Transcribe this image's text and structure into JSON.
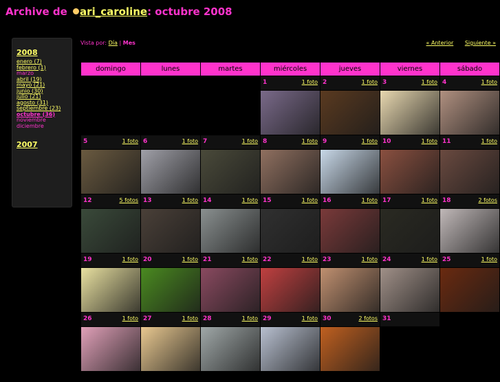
{
  "header": {
    "prefix": "Archive de",
    "user": "ari_caroline",
    "suffix": ": octubre 2008"
  },
  "view": {
    "label": "Vista por:",
    "day": "Día",
    "sep": "|",
    "month": "Mes",
    "prev": "« Anterior",
    "next": "Siguiente »"
  },
  "sidebar": {
    "year1": "2008",
    "months": [
      {
        "label": "enero (7)",
        "state": "link"
      },
      {
        "label": "febrero (1)",
        "state": "link"
      },
      {
        "label": "marzo",
        "state": "empty"
      },
      {
        "label": "abril (19)",
        "state": "link"
      },
      {
        "label": "mayo (21)",
        "state": "link"
      },
      {
        "label": "junio (30)",
        "state": "link"
      },
      {
        "label": "julio (21)",
        "state": "link"
      },
      {
        "label": "agosto (31)",
        "state": "link"
      },
      {
        "label": "septiembre (23)",
        "state": "link"
      },
      {
        "label": "octubre (36)",
        "state": "current"
      },
      {
        "label": "noviembre",
        "state": "empty"
      },
      {
        "label": "diciembre",
        "state": "empty"
      }
    ],
    "year2": "2007"
  },
  "calendar": {
    "daynames": [
      "domingo",
      "lunes",
      "martes",
      "miércoles",
      "jueves",
      "viernes",
      "sábado"
    ],
    "weeks": [
      [
        null,
        null,
        null,
        {
          "day": "1",
          "photos": "1 foto",
          "color": "#7a6a8a"
        },
        {
          "day": "2",
          "photos": "1 foto",
          "color": "#5a3a20"
        },
        {
          "day": "3",
          "photos": "1 foto",
          "color": "#e8d8b0"
        },
        {
          "day": "4",
          "photos": "1 foto",
          "color": "#b09080"
        }
      ],
      [
        {
          "day": "5",
          "photos": "1 foto",
          "color": "#6a5a40"
        },
        {
          "day": "6",
          "photos": "1 foto",
          "color": "#a0a0a8"
        },
        {
          "day": "7",
          "photos": "1 foto",
          "color": "#4a4a3a"
        },
        {
          "day": "8",
          "photos": "1 foto",
          "color": "#907060"
        },
        {
          "day": "9",
          "photos": "1 foto",
          "color": "#c8d8e8"
        },
        {
          "day": "10",
          "photos": "1 foto",
          "color": "#8a5040"
        },
        {
          "day": "11",
          "photos": "1 foto",
          "color": "#6a4a40"
        }
      ],
      [
        {
          "day": "12",
          "photos": "5 fotos",
          "color": "#3a4a3a"
        },
        {
          "day": "13",
          "photos": "1 foto",
          "color": "#4a4038"
        },
        {
          "day": "14",
          "photos": "1 foto",
          "color": "#8a9090"
        },
        {
          "day": "15",
          "photos": "1 foto",
          "color": "#303030"
        },
        {
          "day": "16",
          "photos": "1 foto",
          "color": "#7a3a3a"
        },
        {
          "day": "17",
          "photos": "1 foto",
          "color": "#2a2a22"
        },
        {
          "day": "18",
          "photos": "2 fotos",
          "color": "#c0b8b8"
        }
      ],
      [
        {
          "day": "19",
          "photos": "1 foto",
          "color": "#e8e0a0"
        },
        {
          "day": "20",
          "photos": "1 foto",
          "color": "#4a8a20"
        },
        {
          "day": "21",
          "photos": "1 foto",
          "color": "#8a4a60"
        },
        {
          "day": "22",
          "photos": "1 foto",
          "color": "#c04040"
        },
        {
          "day": "23",
          "photos": "1 foto",
          "color": "#c09070"
        },
        {
          "day": "24",
          "photos": "1 foto",
          "color": "#a09088"
        },
        {
          "day": "25",
          "photos": "1 foto",
          "color": "#6a2a10"
        }
      ],
      [
        {
          "day": "26",
          "photos": "1 foto",
          "color": "#e0a0b8"
        },
        {
          "day": "27",
          "photos": "1 foto",
          "color": "#e8c890"
        },
        {
          "day": "28",
          "photos": "1 foto",
          "color": "#a0a8a8"
        },
        {
          "day": "29",
          "photos": "1 foto",
          "color": "#b8c0d0"
        },
        {
          "day": "30",
          "photos": "2 fotos",
          "color": "#c06020"
        },
        {
          "day": "31",
          "photos": "",
          "color": ""
        },
        null
      ]
    ]
  }
}
